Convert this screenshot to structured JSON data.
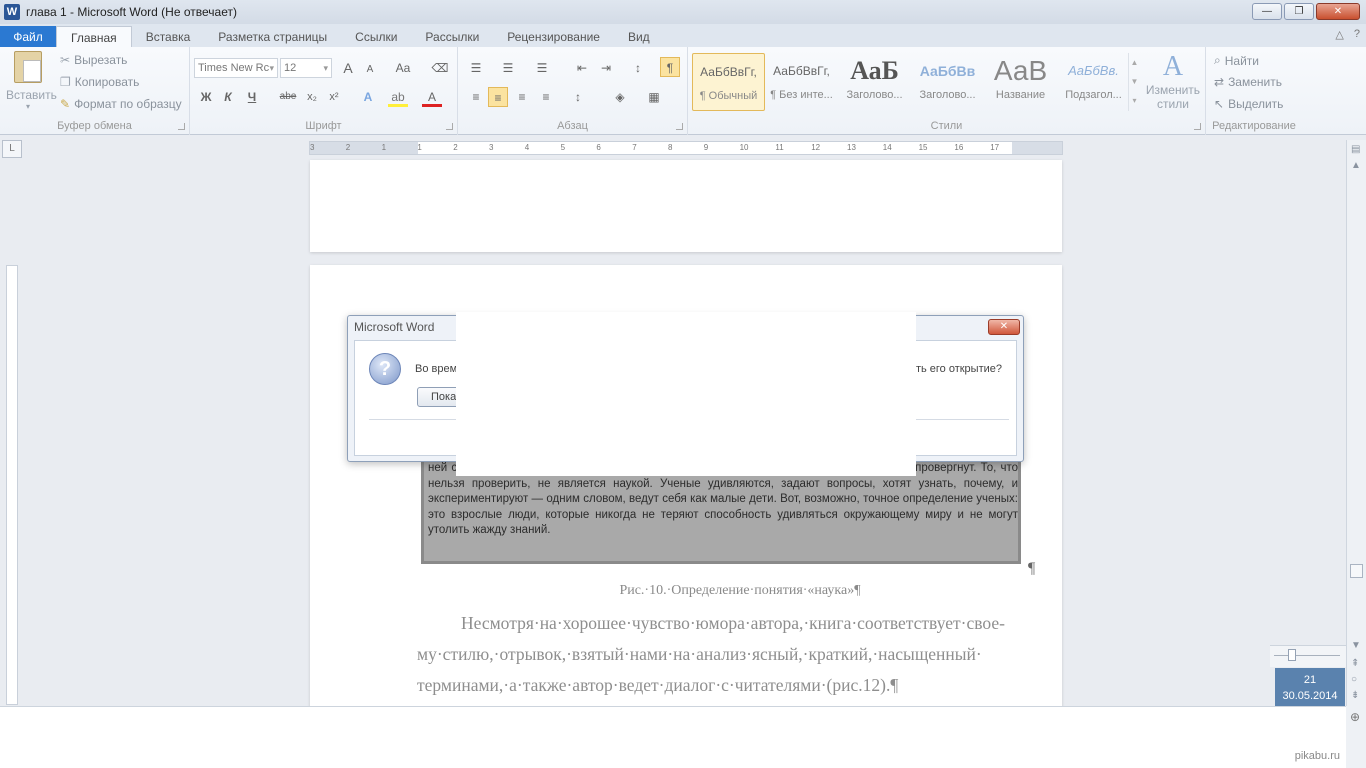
{
  "window": {
    "title": "глава 1 - Microsoft Word (Не отвечает)",
    "logo_letter": "W",
    "minimize": "—",
    "restore": "❐",
    "close": "✕"
  },
  "tabs": [
    {
      "label": "Файл"
    },
    {
      "label": "Главная"
    },
    {
      "label": "Вставка"
    },
    {
      "label": "Разметка страницы"
    },
    {
      "label": "Ссылки"
    },
    {
      "label": "Рассылки"
    },
    {
      "label": "Рецензирование"
    },
    {
      "label": "Вид"
    }
  ],
  "ribbon": {
    "clipboard": {
      "label": "Буфер обмена",
      "paste": "Вставить",
      "cut": "Вырезать",
      "copy": "Копировать",
      "format_painter": "Формат по образцу"
    },
    "font": {
      "label": "Шрифт",
      "font_name": "Times New Rc",
      "font_size": "12",
      "grow": "A",
      "shrink": "A",
      "case": "Aa",
      "bold": "Ж",
      "italic": "К",
      "underline": "Ч",
      "strike": "abe",
      "subscript": "x₂",
      "superscript": "x²"
    },
    "paragraph": {
      "label": "Абзац",
      "pilcrow": "¶"
    },
    "styles": {
      "label": "Стили",
      "items": [
        {
          "preview": "АаБбВвГг,",
          "name": "¶ Обычный"
        },
        {
          "preview": "АаБбВвГг,",
          "name": "¶ Без инте..."
        },
        {
          "preview": "АаБ",
          "name": "Заголово..."
        },
        {
          "preview": "АаБбВв",
          "name": "Заголово..."
        },
        {
          "preview": "АаВ",
          "name": "Название"
        },
        {
          "preview": "АаБбВв.",
          "name": "Подзагол..."
        }
      ],
      "change_styles_line1": "Изменить",
      "change_styles_line2": "стили"
    },
    "editing": {
      "label": "Редактирование",
      "find": "Найти",
      "replace": "Заменить",
      "select": "Выделить"
    }
  },
  "ruler": {
    "numbers": [
      "3",
      "2",
      "1",
      "1",
      "2",
      "3",
      "4",
      "5",
      "6",
      "7",
      "8",
      "9",
      "10",
      "11",
      "12",
      "13",
      "14",
      "15",
      "16",
      "17"
    ],
    "corner": "L"
  },
  "dialog": {
    "title": "Microsoft Word",
    "message_start": "Во время",
    "message_end": "ть его открытие?",
    "button": "Показ",
    "close": "✕",
    "icon": "?"
  },
  "scan": {
    "text": "ней с экспериментов в качестве рабочих гипотез до тех пор, пока другие ученые их не опровергнут. То, что нельзя проверить, не является наукой. Ученые удивляются, задают вопросы, хотят узнать, почему, и экспериментируют — одним словом, ведут себя как малые дети. Вот, возможно, точное определение ученых: это взрослые люди, которые никогда не теряют способность удивляться окружающему миру и не могут утолить жажду знаний."
  },
  "document": {
    "caption": "Рис.·10.·Определение·понятия·«наука»¶",
    "paragraph": "Несмотря·на·хорошее·чувство·юмора·автора,·книга·соответствует·свое-му·стилю,·отрывок,·взятый·нами·на·анализ·ясный,·краткий,·насыщенный· терминами,·а·также·автор·ведет·диалог·с·читателями·(рис.12).¶",
    "pilcrow": "¶"
  },
  "clock": {
    "time": "21",
    "date": "30.05.2014"
  },
  "watermark": "pikabu.ru"
}
